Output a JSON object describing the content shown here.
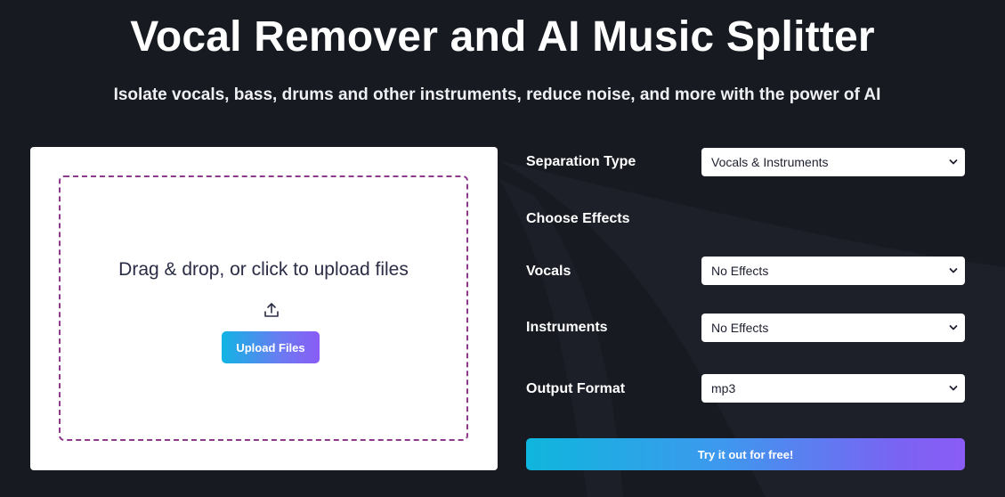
{
  "header": {
    "title": "Vocal Remover and AI Music Splitter",
    "subtitle": "Isolate vocals, bass, drums and other instruments, reduce noise, and more with the power of AI"
  },
  "upload": {
    "prompt": "Drag & drop, or click to upload files",
    "button_label": "Upload Files",
    "icon": "upload-icon"
  },
  "options": {
    "separation_type": {
      "label": "Separation Type",
      "value": "Vocals & Instruments"
    },
    "effects_heading": "Choose Effects",
    "vocals": {
      "label": "Vocals",
      "value": "No Effects"
    },
    "instruments": {
      "label": "Instruments",
      "value": "No Effects"
    },
    "output_format": {
      "label": "Output Format",
      "value": "mp3"
    },
    "submit_label": "Try it out for free!"
  },
  "colors": {
    "background": "#171a20",
    "dropzone_border": "#8e3a8c",
    "gradient_start": "#11b4e4",
    "gradient_end": "#8a5cf6"
  }
}
